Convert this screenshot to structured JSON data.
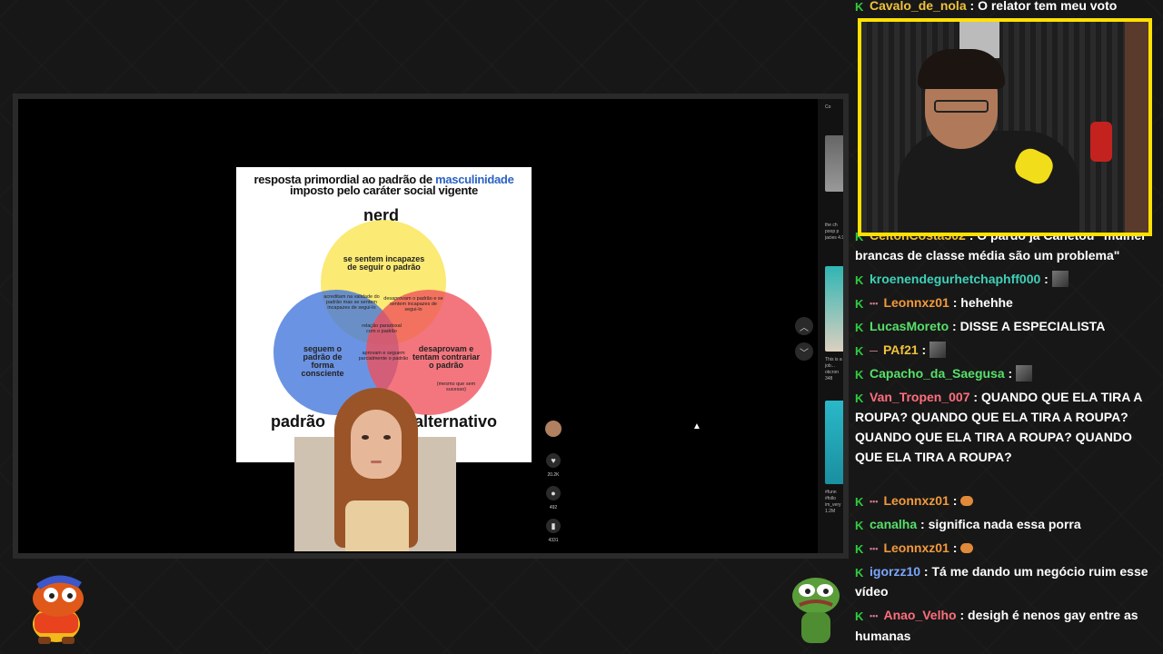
{
  "video": {
    "slide_title_part1": "resposta primordial ao padrão de ",
    "slide_title_highlight": "masculinidade",
    "slide_title_part2": "imposto pelo caráter social vigente",
    "venn": {
      "top_label": "nerd",
      "left_label": "padrão",
      "right_label": "alternativo",
      "top_text": "se sentem incapazes de seguir o padrão",
      "left_text": "seguem o padrão de forma consciente",
      "right_text": "desaprovam e tentam contrariar o padrão",
      "right_note": "(mesmo que sem sucesso)",
      "top_left_text": "acreditam na validade do padrão mas se sentem incapazes de segui-lo",
      "top_right_text": "desaprovam o padrão e se sentem incapazes de segui-lo",
      "center_text": "relação paradoxal com o padrão",
      "bottom_text": "aprovam e seguem parcialmente o padrão"
    },
    "actions": {
      "like_count": "20.2K",
      "comment_count": "492",
      "save_count": "4331"
    },
    "side_captions": [
      "Co",
      "the ch poop p jacies 4.9",
      "This is a job... okcron 348",
      "#funn #follo im_very 1.2M"
    ]
  },
  "chat": {
    "messages": [
      {
        "user": "Cavalo_de_nola",
        "user_color": "#f0c23a",
        "sub": false,
        "text": "O relator tem meu voto",
        "emote": null
      },
      {
        "user": "CeltonCosta302",
        "user_color": "#f0c23a",
        "sub": false,
        "text": "O pardo já Canetou \"mulher brancas de classe média são um problema\"",
        "emote": null
      },
      {
        "user": "kroenendegurhetchaphff000",
        "user_color": "#3ed1b8",
        "sub": false,
        "text": "",
        "emote": "square"
      },
      {
        "user": "Leonnxz01",
        "user_color": "#f29a3c",
        "sub": true,
        "text": "hehehhe",
        "emote": null
      },
      {
        "user": "LucasMoreto",
        "user_color": "#57e06a",
        "sub": false,
        "text": "DISSE A ESPECIALISTA",
        "emote": null
      },
      {
        "user": "PAf21",
        "user_color": "#f0c23a",
        "sub": true,
        "text": "",
        "emote": "square"
      },
      {
        "user": "Capacho_da_Saegusa",
        "user_color": "#57e06a",
        "sub": false,
        "text": "",
        "emote": "square"
      },
      {
        "user": "Van_Tropen_007",
        "user_color": "#ff6f7d",
        "sub": false,
        "text": "QUANDO QUE ELA TIRA A ROUPA? QUANDO QUE ELA TIRA A ROUPA? QUANDO QUE ELA TIRA A ROUPA? QUANDO QUE ELA TIRA A ROUPA?",
        "emote": "drops"
      },
      {
        "user": "Leonnxz01",
        "user_color": "#f29a3c",
        "sub": true,
        "text": "",
        "emote": "bun"
      },
      {
        "user": "canalha",
        "user_color": "#57e06a",
        "sub": false,
        "text": "significa nada essa porra",
        "emote": null
      },
      {
        "user": "Leonnxz01",
        "user_color": "#f29a3c",
        "sub": true,
        "text": "",
        "emote": "bun"
      },
      {
        "user": "igorzz10",
        "user_color": "#7aa7ff",
        "sub": false,
        "text": "Tá me dando um negócio ruim esse vídeo",
        "emote": null
      },
      {
        "user": "Anao_Velho",
        "user_color": "#ff6f7d",
        "sub": true,
        "text": "desigh é nenos gay entre as humanas",
        "emote": null
      }
    ]
  },
  "colors": {
    "webcam_border": "#ffe100",
    "badge_green": "#2ecc40"
  }
}
